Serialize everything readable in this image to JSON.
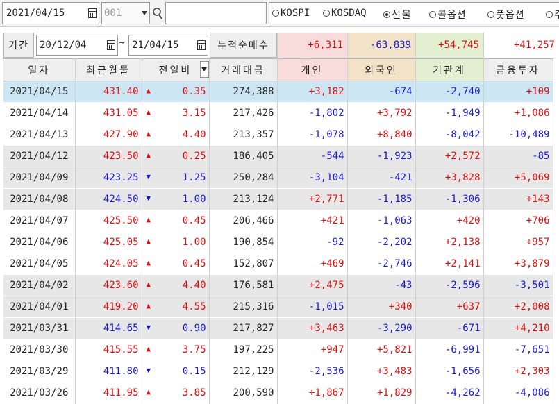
{
  "top": {
    "date": "2021/04/15",
    "code": "001",
    "search_text": "",
    "radios": [
      {
        "label": "KOSPI",
        "checked": false
      },
      {
        "label": "KOSDAQ",
        "checked": false
      },
      {
        "label": "선물",
        "checked": true
      },
      {
        "label": "콜옵션",
        "checked": false
      },
      {
        "label": "풋옵션",
        "checked": false
      },
      {
        "label": "주",
        "checked": false
      }
    ]
  },
  "period": {
    "label": "기간",
    "from": "20/12/04",
    "sep": "~",
    "to": "21/04/15",
    "cum_label": "누적순매수",
    "sums": [
      "+6,311",
      "-63,839",
      "+54,745",
      "+41,257"
    ]
  },
  "table": {
    "headers": [
      "일자",
      "최근월물",
      "전일비",
      "거래대금",
      "개인",
      "외국인",
      "기관계",
      "금융투자"
    ],
    "rows": [
      {
        "date": "2021/04/15",
        "price": "431.40",
        "dir": "up",
        "chg": "0.35",
        "amount": "274,388",
        "ind": "+3,182",
        "for": "-674",
        "inst": "-2,740",
        "fin": "+109",
        "style": "sel"
      },
      {
        "date": "2021/04/14",
        "price": "431.05",
        "dir": "up",
        "chg": "3.15",
        "amount": "217,426",
        "ind": "-1,802",
        "for": "+3,792",
        "inst": "-1,949",
        "fin": "+1,086",
        "style": ""
      },
      {
        "date": "2021/04/13",
        "price": "427.90",
        "dir": "up",
        "chg": "4.40",
        "amount": "213,357",
        "ind": "-1,078",
        "for": "+8,840",
        "inst": "-8,042",
        "fin": "-10,489",
        "style": ""
      },
      {
        "date": "2021/04/12",
        "price": "423.50",
        "dir": "up",
        "chg": "0.25",
        "amount": "186,405",
        "ind": "-544",
        "for": "-1,923",
        "inst": "+2,572",
        "fin": "-85",
        "style": "gray"
      },
      {
        "date": "2021/04/09",
        "price": "423.25",
        "dir": "down",
        "chg": "1.25",
        "amount": "250,284",
        "ind": "-3,104",
        "for": "-421",
        "inst": "+3,828",
        "fin": "+5,069",
        "style": "gray"
      },
      {
        "date": "2021/04/08",
        "price": "424.50",
        "dir": "down",
        "chg": "1.00",
        "amount": "213,124",
        "ind": "+2,771",
        "for": "-1,185",
        "inst": "-1,306",
        "fin": "+143",
        "style": "gray"
      },
      {
        "date": "2021/04/07",
        "price": "425.50",
        "dir": "up",
        "chg": "0.45",
        "amount": "206,466",
        "ind": "+421",
        "for": "-1,063",
        "inst": "+420",
        "fin": "+706",
        "style": ""
      },
      {
        "date": "2021/04/06",
        "price": "425.05",
        "dir": "up",
        "chg": "1.00",
        "amount": "190,854",
        "ind": "-92",
        "for": "-2,202",
        "inst": "+2,138",
        "fin": "+957",
        "style": ""
      },
      {
        "date": "2021/04/05",
        "price": "424.05",
        "dir": "up",
        "chg": "0.45",
        "amount": "152,807",
        "ind": "+469",
        "for": "-2,746",
        "inst": "+2,141",
        "fin": "+3,879",
        "style": ""
      },
      {
        "date": "2021/04/02",
        "price": "423.60",
        "dir": "up",
        "chg": "4.40",
        "amount": "176,581",
        "ind": "+2,475",
        "for": "-43",
        "inst": "-2,596",
        "fin": "-3,501",
        "style": "gray"
      },
      {
        "date": "2021/04/01",
        "price": "419.20",
        "dir": "up",
        "chg": "4.55",
        "amount": "215,316",
        "ind": "-1,015",
        "for": "+340",
        "inst": "+637",
        "fin": "+2,008",
        "style": "gray"
      },
      {
        "date": "2021/03/31",
        "price": "414.65",
        "dir": "down",
        "chg": "0.90",
        "amount": "217,827",
        "ind": "+3,463",
        "for": "-3,290",
        "inst": "-671",
        "fin": "+4,210",
        "style": "gray"
      },
      {
        "date": "2021/03/30",
        "price": "415.55",
        "dir": "up",
        "chg": "3.75",
        "amount": "197,225",
        "ind": "+947",
        "for": "+5,821",
        "inst": "-6,991",
        "fin": "-7,651",
        "style": ""
      },
      {
        "date": "2021/03/29",
        "price": "411.80",
        "dir": "down",
        "chg": "0.15",
        "amount": "212,129",
        "ind": "-2,536",
        "for": "+3,483",
        "inst": "-1,656",
        "fin": "+2,303",
        "style": ""
      },
      {
        "date": "2021/03/26",
        "price": "411.95",
        "dir": "up",
        "chg": "3.85",
        "amount": "200,590",
        "ind": "+1,867",
        "for": "+1,829",
        "inst": "-4,262",
        "fin": "-4,086",
        "style": ""
      }
    ]
  },
  "colors": {
    "up": "#e01010",
    "down": "#1a1ad0",
    "header_individual": "#f8dcdc",
    "header_foreign": "#f1e2c8",
    "header_inst": "#e3efd1",
    "selected_row": "#cce6f4",
    "shaded_row": "#e7e7e7"
  }
}
